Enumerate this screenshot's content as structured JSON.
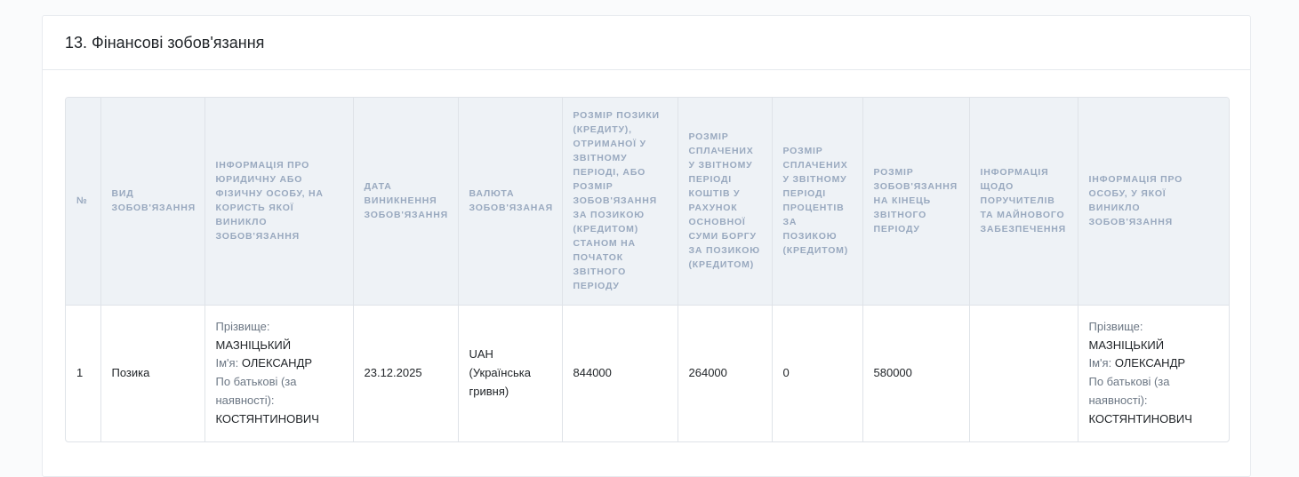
{
  "section": {
    "title": "13. Фінансові зобов'язання"
  },
  "table": {
    "headers": [
      "№",
      "Вид зобов'язання",
      "Інформація про юридичну або фізичну особу, на користь якої виникло зобов'язання",
      "Дата виникнення зобов'язання",
      "Валюта зобов'язаная",
      "Розмір позики (кредиту), отриманої у звітному періоді, або розмір зобов'язання за позикою (кредитом) станом на початок звітного періоду",
      "Розмір сплачених у звітному періоді коштів у рахунок основної суми боргу за позикою (кредитом)",
      "Розмір сплачених у звітному періоді процентів за позикою (кредитом)",
      "Розмір зобов'язання на кінець звітного періоду",
      "Інформація щодо поручителів та майнового забезпечення",
      "Інформація про особу, у якої виникло зобов'язання"
    ],
    "rows": [
      {
        "num": "1",
        "type": "Позика",
        "creditor": {
          "surname_label": "Прізвище:",
          "surname": "МАЗНІЦЬКИЙ",
          "name_label": "Ім'я:",
          "name": "ОЛЕКСАНДР",
          "patronymic_label": "По батькові (за наявності):",
          "patronymic": "КОСТЯНТИНОВИЧ"
        },
        "date": "23.12.2025",
        "currency_code": "UAH",
        "currency_name": "(Українська гривня)",
        "loan_amount": "844000",
        "principal_paid": "264000",
        "interest_paid": "0",
        "end_balance": "580000",
        "guarantors": "",
        "debtor": {
          "surname_label": "Прізвище:",
          "surname": "МАЗНІЦЬКИЙ",
          "name_label": "Ім'я:",
          "name": "ОЛЕКСАНДР",
          "patronymic_label": "По батькові (за наявності):",
          "patronymic": "КОСТЯНТИНОВИЧ"
        }
      }
    ]
  }
}
